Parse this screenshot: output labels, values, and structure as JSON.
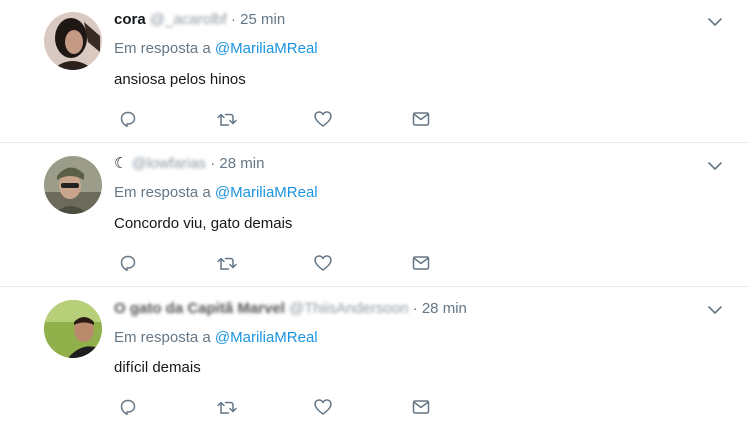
{
  "colors": {
    "link": "#1b95e0",
    "secondary": "#657786",
    "icon": "#657786",
    "divider": "#e6ecf0"
  },
  "tweets": [
    {
      "name": "cora",
      "handle": "@_acarolbf",
      "time": "25 min",
      "reply_prefix": "Em resposta a",
      "reply_mention": "@MariliaMReal",
      "text": "ansiosa pelos hinos",
      "actions": [
        "reply-icon",
        "retweet-icon",
        "like-icon",
        "direct-message-icon"
      ],
      "menu_icon": "chevron-down-icon"
    },
    {
      "name": "☾",
      "handle": "@lowfarias",
      "time": "28 min",
      "reply_prefix": "Em resposta a",
      "reply_mention": "@MariliaMReal",
      "text": "Concordo viu, gato demais",
      "actions": [
        "reply-icon",
        "retweet-icon",
        "like-icon",
        "direct-message-icon"
      ],
      "menu_icon": "chevron-down-icon"
    },
    {
      "name": "O gato da Capitã Marvel",
      "handle": "@ThiisAndersoon",
      "time": "28 min",
      "reply_prefix": "Em resposta a",
      "reply_mention": "@MariliaMReal",
      "text": "difícil demais",
      "actions": [
        "reply-icon",
        "retweet-icon",
        "like-icon",
        "direct-message-icon"
      ],
      "menu_icon": "chevron-down-icon"
    }
  ]
}
